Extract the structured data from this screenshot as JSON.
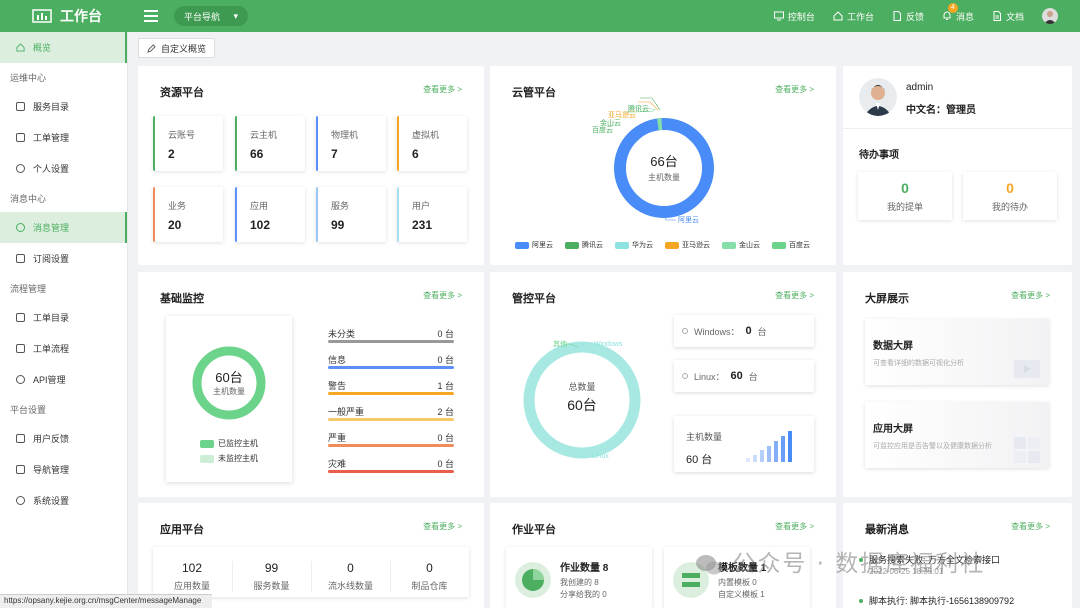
{
  "app": {
    "title": "工作台",
    "nav_select": "平台导航"
  },
  "top_nav": [
    {
      "label": "控制台",
      "icon": "monitor-icon"
    },
    {
      "label": "工作台",
      "icon": "home-icon"
    },
    {
      "label": "反馈",
      "icon": "file-icon"
    },
    {
      "label": "消息",
      "icon": "bell-icon",
      "badge": "4"
    },
    {
      "label": "文档",
      "icon": "doc-icon"
    }
  ],
  "sidebar": {
    "overview": "概览",
    "groups": [
      {
        "title": "运维中心",
        "items": [
          "服务目录",
          "工单管理",
          "个人设置"
        ]
      },
      {
        "title": "消息中心",
        "items": [
          "消息管理",
          "订阅设置"
        ]
      },
      {
        "title": "流程管理",
        "items": [
          "工单目录",
          "工单流程",
          "API管理"
        ]
      },
      {
        "title": "平台设置",
        "items": [
          "用户反馈",
          "导航管理",
          "系统设置"
        ]
      }
    ]
  },
  "status_url": "https://opsany.kejie.org.cn/msgCenter/messageManage",
  "tab_button": "自定义概览",
  "more_label": "查看更多 >",
  "resource": {
    "title": "资源平台",
    "items": [
      {
        "label": "云账号",
        "value": "2",
        "color": "#4cae60"
      },
      {
        "label": "云主机",
        "value": "66",
        "color": "#4cae60"
      },
      {
        "label": "物理机",
        "value": "7",
        "color": "#5b8ff9"
      },
      {
        "label": "虚拟机",
        "value": "6",
        "color": "#f5a623"
      },
      {
        "label": "业务",
        "value": "20",
        "color": "#f08c5a"
      },
      {
        "label": "应用",
        "value": "102",
        "color": "#5b8ff9"
      },
      {
        "label": "服务",
        "value": "99",
        "color": "#9ac7f5"
      },
      {
        "label": "用户",
        "value": "231",
        "color": "#a6e0f0"
      }
    ]
  },
  "cloud": {
    "title": "云管平台",
    "center_value": "66台",
    "center_label": "主机数量",
    "legend": [
      {
        "name": "阿里云",
        "color": "#4a8cf7"
      },
      {
        "name": "腾讯云",
        "color": "#4cae60"
      },
      {
        "name": "华为云",
        "color": "#8ee3e0"
      },
      {
        "name": "亚马逊云",
        "color": "#f5a623"
      },
      {
        "name": "金山云",
        "color": "#86dfa8"
      },
      {
        "name": "百度云",
        "color": "#6bd38a"
      }
    ],
    "callouts": [
      "亚马逊云",
      "腾讯云",
      "金山云",
      "百度云",
      "阿里云"
    ]
  },
  "user": {
    "name": "admin",
    "cn_label": "中文名：",
    "cn_name": "管理员"
  },
  "todo": {
    "title": "待办事项",
    "items": [
      {
        "value": "0",
        "label": "我的提单",
        "color": "#4cae60"
      },
      {
        "value": "0",
        "label": "我的待办",
        "color": "#f5a623"
      }
    ]
  },
  "monitor": {
    "title": "基础监控",
    "center_value": "60台",
    "center_label": "主机数量",
    "legend": [
      "已监控主机",
      "未监控主机"
    ],
    "rows": [
      {
        "label": "未分类",
        "value": "0 台",
        "color": "#999999"
      },
      {
        "label": "信息",
        "value": "0 台",
        "color": "#5b8ff9"
      },
      {
        "label": "警告",
        "value": "1 台",
        "color": "#f5a623"
      },
      {
        "label": "一般严重",
        "value": "2 台",
        "color": "#f5c86a"
      },
      {
        "label": "严重",
        "value": "0 台",
        "color": "#f08c5a"
      },
      {
        "label": "灾难",
        "value": "0 台",
        "color": "#e8604c"
      }
    ]
  },
  "control": {
    "title": "管控平台",
    "center_label": "总数量",
    "center_value": "60台",
    "callouts": [
      "其他",
      "Windows",
      "Linux"
    ],
    "windows_label": "Windows：",
    "windows_value": "0",
    "unit": "台",
    "linux_label": "Linux：",
    "linux_value": "60",
    "hosts_label": "主机数量",
    "hosts_value": "60 台"
  },
  "screens": {
    "title": "大屏展示",
    "items": [
      {
        "title": "数据大屏",
        "desc": "可查看详细的数据可视化分析"
      },
      {
        "title": "应用大屏",
        "desc": "可监控应用是否告警以及健康数据分析"
      }
    ]
  },
  "apps": {
    "title": "应用平台",
    "items": [
      {
        "value": "102",
        "label": "应用数量"
      },
      {
        "value": "99",
        "label": "服务数量"
      },
      {
        "value": "0",
        "label": "流水线数量"
      },
      {
        "value": "0",
        "label": "制品仓库"
      }
    ]
  },
  "jobs": {
    "title": "作业平台",
    "job_count": "作业数量 8",
    "job_sub1": "我创建的 8",
    "job_sub2": "分享给我的 0",
    "tpl_count": "模板数量 1",
    "tpl_sub1": "内置模板 0",
    "tpl_sub2": "自定义模板 1"
  },
  "news": {
    "title": "最新消息",
    "items": [
      {
        "text": "服务搜索失败: 万方全文检索接口",
        "time": "2022-06-25 18:35:01"
      },
      {
        "text": "脚本执行: 脚本执行-1656138909792"
      }
    ]
  },
  "watermark": "公众号 · 数据库福利社"
}
